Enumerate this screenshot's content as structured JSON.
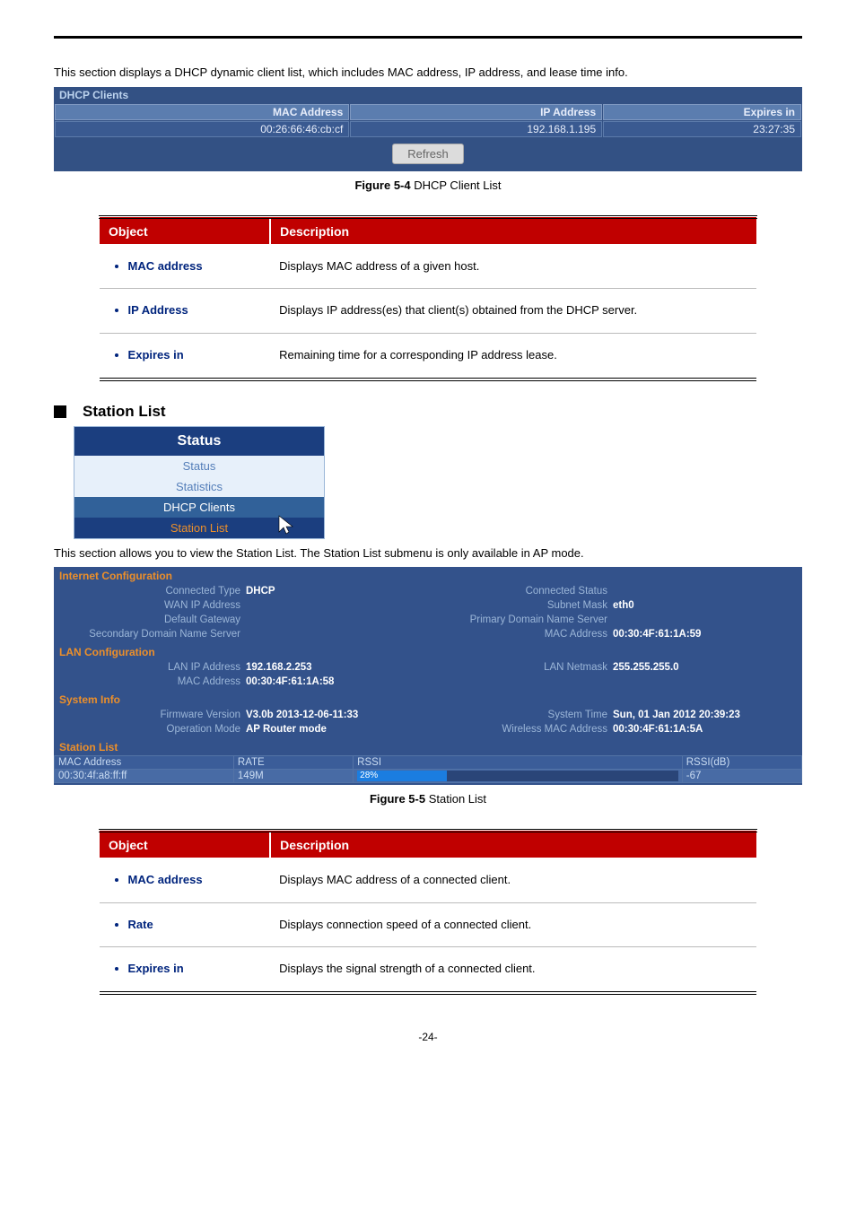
{
  "intro1": "This section displays a DHCP dynamic client list, which includes MAC address, IP address, and lease time info.",
  "dhcp_panel": {
    "title": "DHCP Clients",
    "headers": {
      "mac": "MAC Address",
      "ip": "IP Address",
      "exp": "Expires in"
    },
    "row": {
      "mac": "00:26:66:46:cb:cf",
      "ip": "192.168.1.195",
      "exp": "23:27:35"
    },
    "refresh": "Refresh"
  },
  "fig1": {
    "bold": "Figure 5-4",
    "rest": " DHCP Client List"
  },
  "table1": {
    "h_obj": "Object",
    "h_desc": "Description",
    "rows": [
      {
        "obj": "MAC address",
        "desc": "Displays MAC address of a given host."
      },
      {
        "obj": "IP Address",
        "desc": "Displays IP address(es) that client(s) obtained from the DHCP server."
      },
      {
        "obj": "Expires in",
        "desc": "Remaining time for a corresponding IP address lease."
      }
    ]
  },
  "station_head": "Station List",
  "nav": {
    "title": "Status",
    "items": [
      "Status",
      "Statistics",
      "DHCP Clients",
      "Station List"
    ]
  },
  "intro2": "This section allows you to view the Station List. The Station List submenu is only available in AP mode.",
  "status_panel": {
    "sections": {
      "internet": "Internet Configuration",
      "lan": "LAN Configuration",
      "sys": "System Info",
      "sl": "Station List"
    },
    "internet_rows": [
      {
        "l": "Connected Type",
        "v": "DHCP"
      },
      {
        "l": "Connected Status",
        "v": ""
      },
      {
        "l": "WAN IP Address",
        "v": ""
      },
      {
        "l": "Subnet Mask",
        "v": "eth0"
      },
      {
        "l": "Default Gateway",
        "v": ""
      },
      {
        "l": "Primary Domain Name Server",
        "v": ""
      },
      {
        "l": "Secondary Domain Name Server",
        "v": ""
      },
      {
        "l": "MAC Address",
        "v": "00:30:4F:61:1A:59"
      }
    ],
    "lan_rows": [
      {
        "l": "LAN IP Address",
        "v": "192.168.2.253"
      },
      {
        "l": "LAN Netmask",
        "v": "255.255.255.0"
      },
      {
        "l": "MAC Address",
        "v": "00:30:4F:61:1A:58"
      }
    ],
    "sys_rows": [
      {
        "l": "Firmware Version",
        "v": "V3.0b 2013-12-06-11:33"
      },
      {
        "l": "System Time",
        "v": "Sun, 01 Jan 2012 20:39:23"
      },
      {
        "l": "Operation Mode",
        "v": "AP Router mode"
      },
      {
        "l": "Wireless MAC Address",
        "v": "00:30:4F:61:1A:5A"
      }
    ],
    "sl_headers": {
      "mac": "MAC Address",
      "rate": "RATE",
      "rssi": "RSSI",
      "rssidb": "RSSI(dB)"
    },
    "sl_row": {
      "mac": "00:30:4f:a8:ff:ff",
      "rate": "149M",
      "rssi": "28%",
      "rssidb": "-67"
    }
  },
  "fig2": {
    "bold": "Figure 5-5",
    "rest": " Station List"
  },
  "table2": {
    "h_obj": "Object",
    "h_desc": "Description",
    "rows": [
      {
        "obj": "MAC address",
        "desc": "Displays MAC address of a connected client."
      },
      {
        "obj": "Rate",
        "desc": "Displays connection speed of a connected client."
      },
      {
        "obj": "Expires in",
        "desc": "Displays the signal strength of a connected client."
      }
    ]
  },
  "page": "-24-"
}
